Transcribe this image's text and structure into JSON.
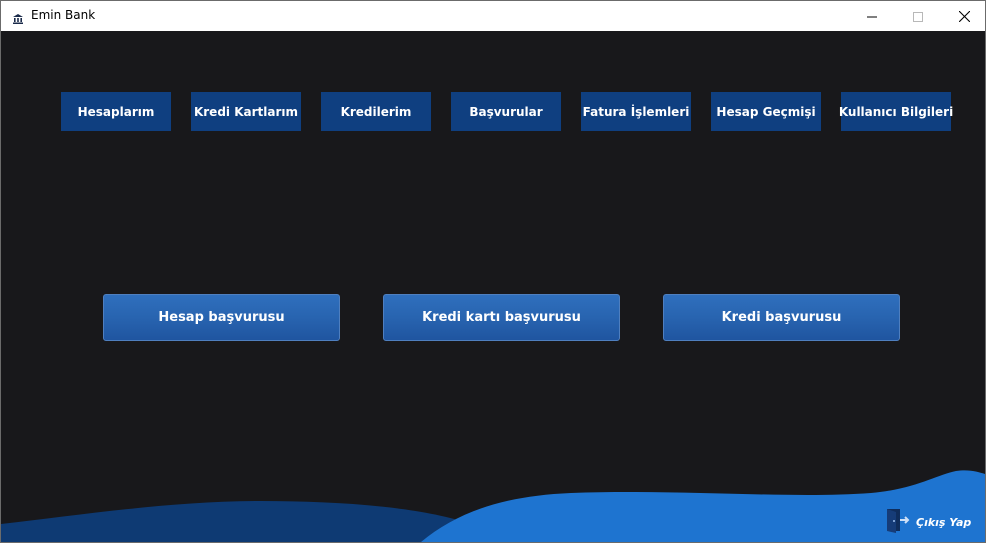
{
  "window": {
    "title": "Emin Bank",
    "icons": {
      "app": "bank-icon",
      "minimize": "minimize-icon",
      "maximize": "maximize-icon",
      "close": "close-icon"
    }
  },
  "nav": {
    "items": [
      {
        "label": "Hesaplarım"
      },
      {
        "label": "Kredi Kartlarım"
      },
      {
        "label": "Kredilerim"
      },
      {
        "label": "Başvurular"
      },
      {
        "label": "Fatura İşlemleri"
      },
      {
        "label": "Hesap Geçmişi"
      },
      {
        "label": "Kullanıcı Bilgileri"
      }
    ]
  },
  "applications": {
    "buttons": [
      {
        "label": "Hesap başvurusu"
      },
      {
        "label": "Kredi kartı başvurusu"
      },
      {
        "label": "Kredi başvurusu"
      }
    ]
  },
  "logout": {
    "label": "Çıkış Yap",
    "icon": "logout-door-icon"
  },
  "colors": {
    "background": "#18181b",
    "nav_button": "#0f3f80",
    "action_button": "#2864b0",
    "wave_dark": "#0e3a73",
    "wave_light": "#1e74d0"
  }
}
